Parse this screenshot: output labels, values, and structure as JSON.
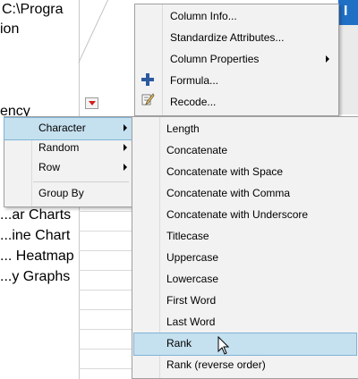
{
  "background": {
    "lines": [
      "C:\\Progra",
      "ion",
      "ency",
      "...ar Charts",
      "...ine Chart",
      "... Heatmap",
      "...y Graphs"
    ],
    "header_glyph": "I"
  },
  "top_menu": {
    "items": [
      {
        "label": "Column Info...",
        "submenu": false,
        "icon": ""
      },
      {
        "label": "Standardize Attributes...",
        "submenu": false,
        "icon": ""
      },
      {
        "label": "Column Properties",
        "submenu": true,
        "icon": ""
      },
      {
        "label": "Formula...",
        "submenu": false,
        "icon": "plus-icon"
      },
      {
        "label": "Recode...",
        "submenu": false,
        "icon": "recode-icon"
      }
    ]
  },
  "left_menu": {
    "items": [
      {
        "label": "Character",
        "submenu": true,
        "highlighted": true
      },
      {
        "label": "Random",
        "submenu": true
      },
      {
        "label": "Row",
        "submenu": true
      },
      {
        "label": "Group By",
        "submenu": false
      }
    ]
  },
  "sub_menu": {
    "items": [
      {
        "label": "Length"
      },
      {
        "label": "Concatenate"
      },
      {
        "label": "Concatenate with Space"
      },
      {
        "label": "Concatenate with Comma"
      },
      {
        "label": "Concatenate with Underscore"
      },
      {
        "label": "Titlecase"
      },
      {
        "label": "Uppercase"
      },
      {
        "label": "Lowercase"
      },
      {
        "label": "First Word"
      },
      {
        "label": "Last Word"
      },
      {
        "label": "Rank",
        "highlighted": true
      },
      {
        "label": "Rank (reverse order)"
      }
    ]
  },
  "colors": {
    "highlight": "#c5e0ef",
    "menu_bg": "#f2f2f2",
    "accent_blue": "#1f6fc5",
    "dropdown_red": "#d21f1f"
  }
}
